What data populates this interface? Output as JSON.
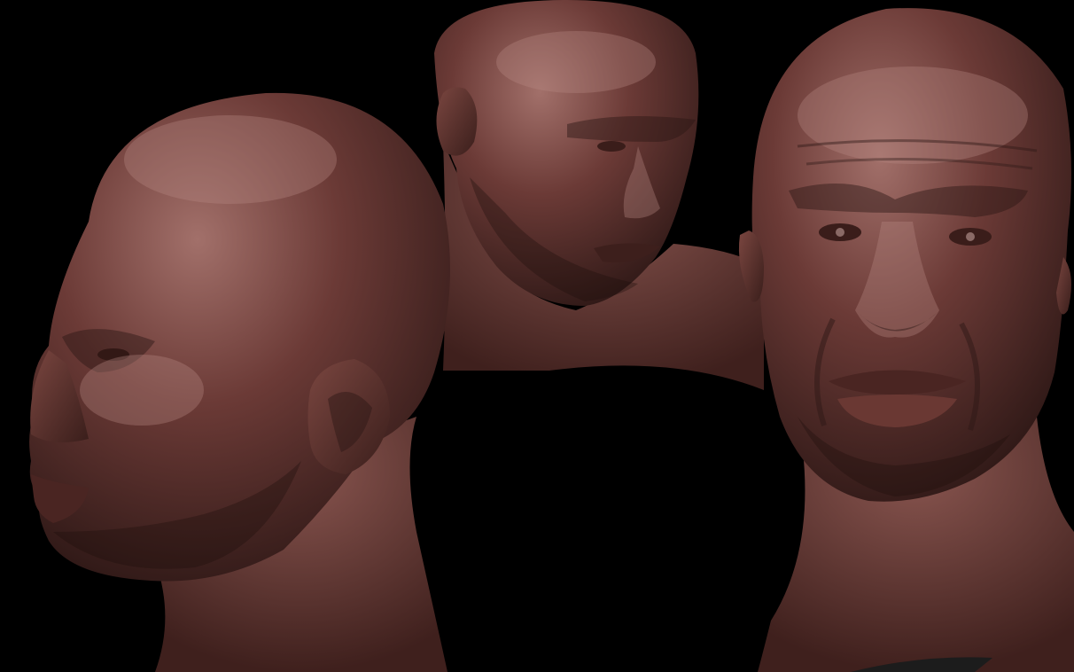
{
  "scene": {
    "background_color": "#4a4c50",
    "clay_base_color": "#6b3a36",
    "clay_highlight_color": "#a2706a",
    "clay_shadow_color": "#2e1816",
    "views": [
      {
        "id": "profile-left"
      },
      {
        "id": "three-quarter-top"
      },
      {
        "id": "front-right"
      }
    ]
  }
}
